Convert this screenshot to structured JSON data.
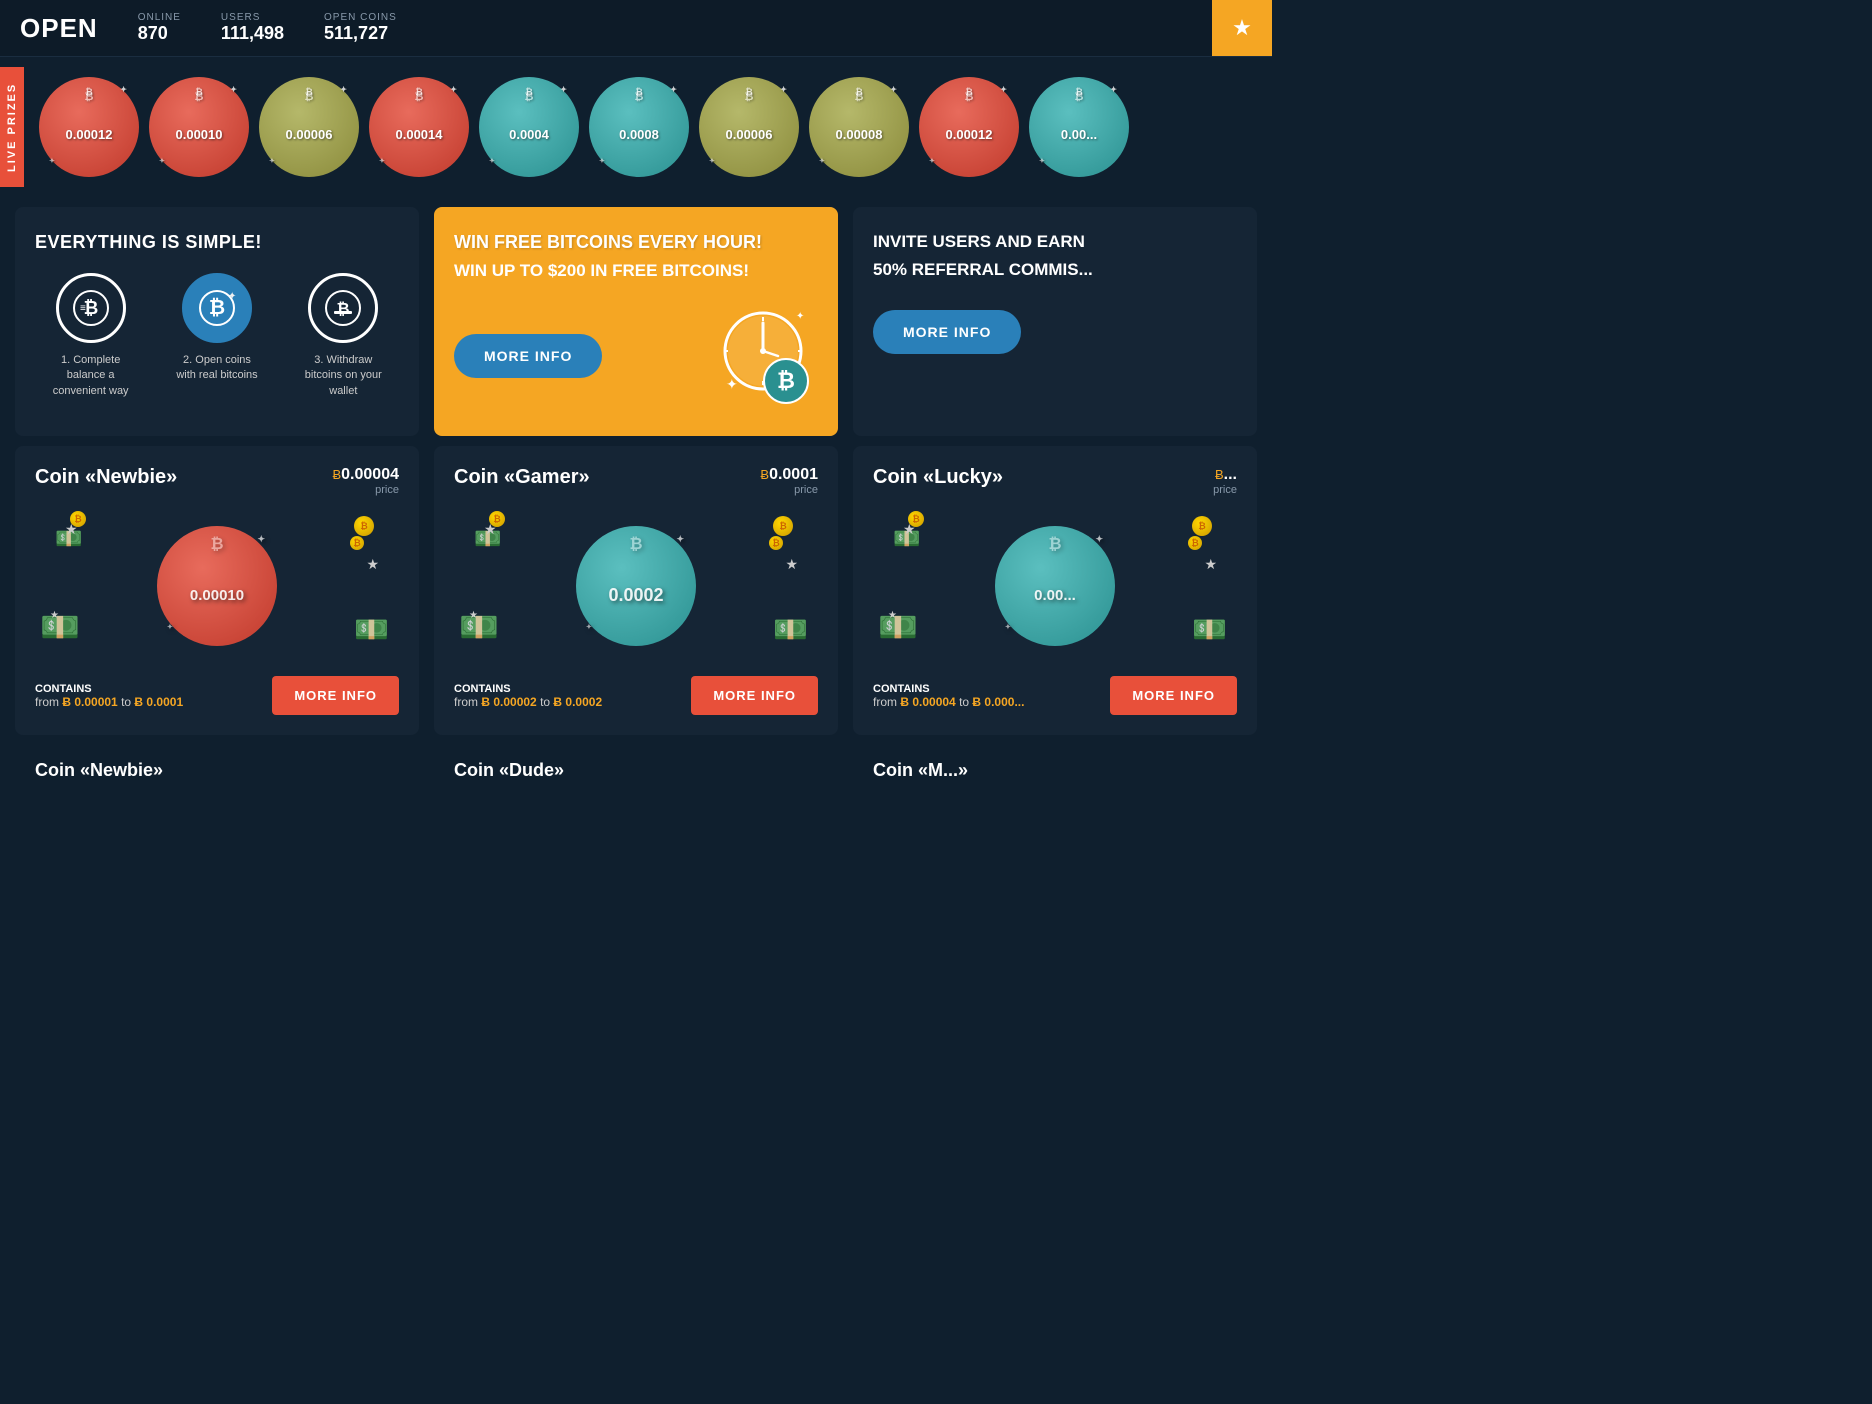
{
  "header": {
    "logo": "OPEN",
    "online_label": "ONLINE",
    "online_value": "870",
    "users_label": "USERS",
    "users_value": "111,498",
    "open_coins_label": "OPEN COINS",
    "open_coins_value": "511,727",
    "header_btn_icon": "★"
  },
  "live_prizes": {
    "label": "LIVE PRIZES",
    "coins": [
      {
        "value": "0.00012",
        "type": "red"
      },
      {
        "value": "0.00010",
        "type": "red"
      },
      {
        "value": "0.00006",
        "type": "olive"
      },
      {
        "value": "0.00014",
        "type": "red"
      },
      {
        "value": "0.0004",
        "type": "teal"
      },
      {
        "value": "0.0008",
        "type": "teal"
      },
      {
        "value": "0.00006",
        "type": "olive"
      },
      {
        "value": "0.00008",
        "type": "olive"
      },
      {
        "value": "0.00012",
        "type": "red"
      },
      {
        "value": "0.00...",
        "type": "teal"
      }
    ]
  },
  "simple_card": {
    "title": "EVERYTHING IS SIMPLE!",
    "steps": [
      {
        "label": "1. Complete balance a convenient way",
        "icon": "💰",
        "type": "outline"
      },
      {
        "label": "2. Open coins with real bitcoins",
        "icon": "₿",
        "type": "blue"
      },
      {
        "label": "3. Withdraw bitcoins on your wallet",
        "icon": "💸",
        "type": "outline"
      }
    ]
  },
  "win_card": {
    "title": "WIN FREE BITCOINS EVERY HOUR!",
    "subtitle": "WIN UP TO $200 IN FREE BITCOINS!",
    "btn_label": "MORE INFO"
  },
  "invite_card": {
    "title": "INVITE USERS AND EARN",
    "subtitle": "50% REFERRAL COMMIS...",
    "btn_label": "MORE INFO"
  },
  "coin_cards": [
    {
      "name": "Coin «Newbie»",
      "btc_symbol": "Ƀ",
      "price": "0.00004",
      "price_label": "price",
      "value": "0.00010",
      "type": "red",
      "contains_label": "CONTAINS",
      "range_from": "Ƀ 0.00001",
      "range_to": "Ƀ 0.0001",
      "btn_label": "MORE INFO"
    },
    {
      "name": "Coin «Gamer»",
      "btc_symbol": "Ƀ",
      "price": "0.0001",
      "price_label": "price",
      "value": "0.0002",
      "type": "teal",
      "contains_label": "CONTAINS",
      "range_from": "Ƀ 0.00002",
      "range_to": "Ƀ 0.0002",
      "btn_label": "MORE INFO"
    },
    {
      "name": "Coin «Lucky»",
      "btc_symbol": "Ƀ",
      "price": "...",
      "price_label": "price",
      "value": "0.00...",
      "type": "teal",
      "contains_label": "CONTAINS",
      "range_from": "Ƀ 0.00004",
      "range_to": "Ƀ 0.000...",
      "btn_label": "MORE INFO"
    }
  ],
  "bottom_coins": [
    {
      "name": "Coin «Newbie»"
    },
    {
      "name": "Coin «Dude»"
    },
    {
      "name": "Coin «M...»"
    }
  ]
}
